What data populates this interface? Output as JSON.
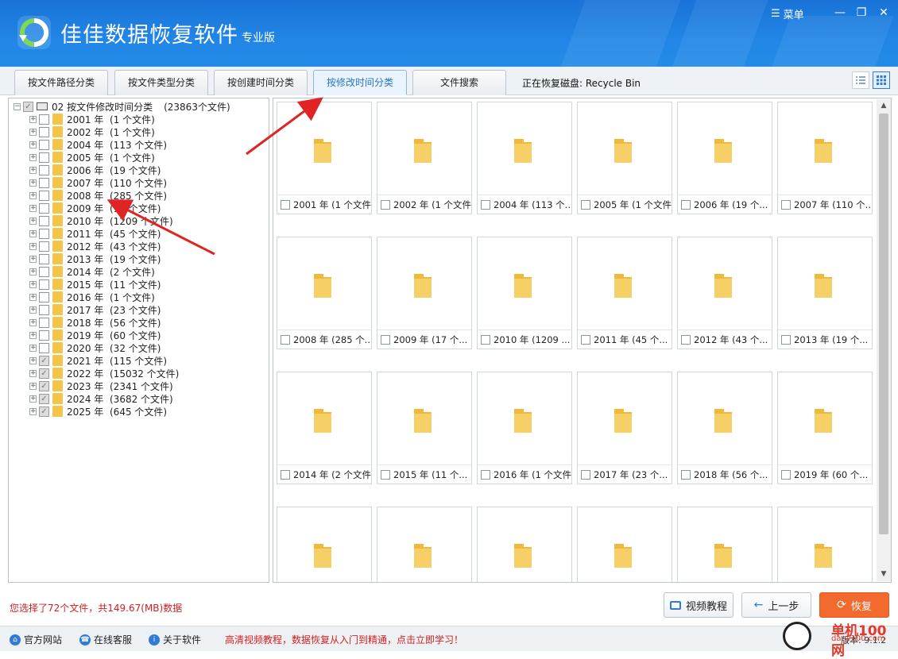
{
  "app": {
    "title": "佳佳数据恢复软件",
    "edition": "专业版",
    "menu_label": "菜单"
  },
  "window_controls": {
    "minimize": "—",
    "maximize": "❐",
    "close": "✕"
  },
  "tabs": [
    {
      "label": "按文件路径分类",
      "active": false
    },
    {
      "label": "按文件类型分类",
      "active": false
    },
    {
      "label": "按创建时间分类",
      "active": false
    },
    {
      "label": "按修改时间分类",
      "active": true
    },
    {
      "label": "文件搜索",
      "active": false
    }
  ],
  "recovering_disk": "正在恢复磁盘: Recycle Bin",
  "tree": {
    "root_label": "02  按文件修改时间分类",
    "root_count": "(23863个文件)",
    "items": [
      {
        "year": "2001 年",
        "count": "(1 个文件)",
        "checked": false
      },
      {
        "year": "2002 年",
        "count": "(1 个文件)",
        "checked": false
      },
      {
        "year": "2004 年",
        "count": "(113 个文件)",
        "checked": false
      },
      {
        "year": "2005 年",
        "count": "(1 个文件)",
        "checked": false
      },
      {
        "year": "2006 年",
        "count": "(19 个文件)",
        "checked": false
      },
      {
        "year": "2007 年",
        "count": "(110 个文件)",
        "checked": false
      },
      {
        "year": "2008 年",
        "count": "(285 个文件)",
        "checked": false
      },
      {
        "year": "2009 年",
        "count": "(17 个文件)",
        "checked": false
      },
      {
        "year": "2010 年",
        "count": "(1209 个文件)",
        "checked": false
      },
      {
        "year": "2011 年",
        "count": "(45 个文件)",
        "checked": false
      },
      {
        "year": "2012 年",
        "count": "(43 个文件)",
        "checked": false
      },
      {
        "year": "2013 年",
        "count": "(19 个文件)",
        "checked": false
      },
      {
        "year": "2014 年",
        "count": "(2 个文件)",
        "checked": false
      },
      {
        "year": "2015 年",
        "count": "(11 个文件)",
        "checked": false
      },
      {
        "year": "2016 年",
        "count": "(1 个文件)",
        "checked": false
      },
      {
        "year": "2017 年",
        "count": "(23 个文件)",
        "checked": false
      },
      {
        "year": "2018 年",
        "count": "(56 个文件)",
        "checked": false
      },
      {
        "year": "2019 年",
        "count": "(60 个文件)",
        "checked": false
      },
      {
        "year": "2020 年",
        "count": "(32 个文件)",
        "checked": false
      },
      {
        "year": "2021 年",
        "count": "(115 个文件)",
        "checked": true
      },
      {
        "year": "2022 年",
        "count": "(15032 个文件)",
        "checked": true
      },
      {
        "year": "2023 年",
        "count": "(2341 个文件)",
        "checked": true
      },
      {
        "year": "2024 年",
        "count": "(3682 个文件)",
        "checked": true
      },
      {
        "year": "2025 年",
        "count": "(645 个文件)",
        "checked": true
      }
    ]
  },
  "grid": {
    "cards": [
      {
        "label": "2001 年 (1 个文件)"
      },
      {
        "label": "2002 年 (1 个文件)"
      },
      {
        "label": "2004 年 (113 个..."
      },
      {
        "label": "2005 年 (1 个文件)"
      },
      {
        "label": "2006 年 (19 个..."
      },
      {
        "label": "2007 年 (110 个..."
      },
      {
        "label": "2008 年 (285 个..."
      },
      {
        "label": "2009 年 (17 个..."
      },
      {
        "label": "2010 年 (1209 ..."
      },
      {
        "label": "2011 年 (45 个..."
      },
      {
        "label": "2012 年 (43 个..."
      },
      {
        "label": "2013 年 (19 个..."
      },
      {
        "label": "2014 年 (2 个文件)"
      },
      {
        "label": "2015 年 (11 个..."
      },
      {
        "label": "2016 年 (1 个文件)"
      },
      {
        "label": "2017 年 (23 个..."
      },
      {
        "label": "2018 年 (56 个..."
      },
      {
        "label": "2019 年 (60 个..."
      },
      {
        "label": ""
      },
      {
        "label": ""
      },
      {
        "label": ""
      },
      {
        "label": ""
      },
      {
        "label": ""
      },
      {
        "label": ""
      }
    ]
  },
  "status": {
    "selection": "您选择了72个文件，共149.67(MB)数据"
  },
  "buttons": {
    "video_tutorial": "视频教程",
    "prev_step": "上一步",
    "recover": "恢复"
  },
  "bottom": {
    "links": [
      "官方网站",
      "在线客服",
      "关于软件"
    ],
    "promo": "高清视频教程，数据恢复从入门到精通，点击立即学习！",
    "version": "版本: 9.1.2"
  },
  "watermark": {
    "site": "单机100网",
    "domain": "danji100.com"
  },
  "colors": {
    "titlebar": "#2186e6",
    "accent": "#2f7bd6",
    "recover_button": "#f26a2e",
    "alert_text": "#d32020",
    "folder": "#f5c44a"
  },
  "icons": {
    "menu": "hamburger-icon",
    "folder": "folder-icon",
    "list_view": "list-view-icon",
    "grid_view": "grid-view-icon",
    "video": "video-icon",
    "back": "arrow-left-icon",
    "recover": "refresh-icon",
    "home": "home-icon",
    "service": "headset-icon",
    "about": "info-icon"
  }
}
